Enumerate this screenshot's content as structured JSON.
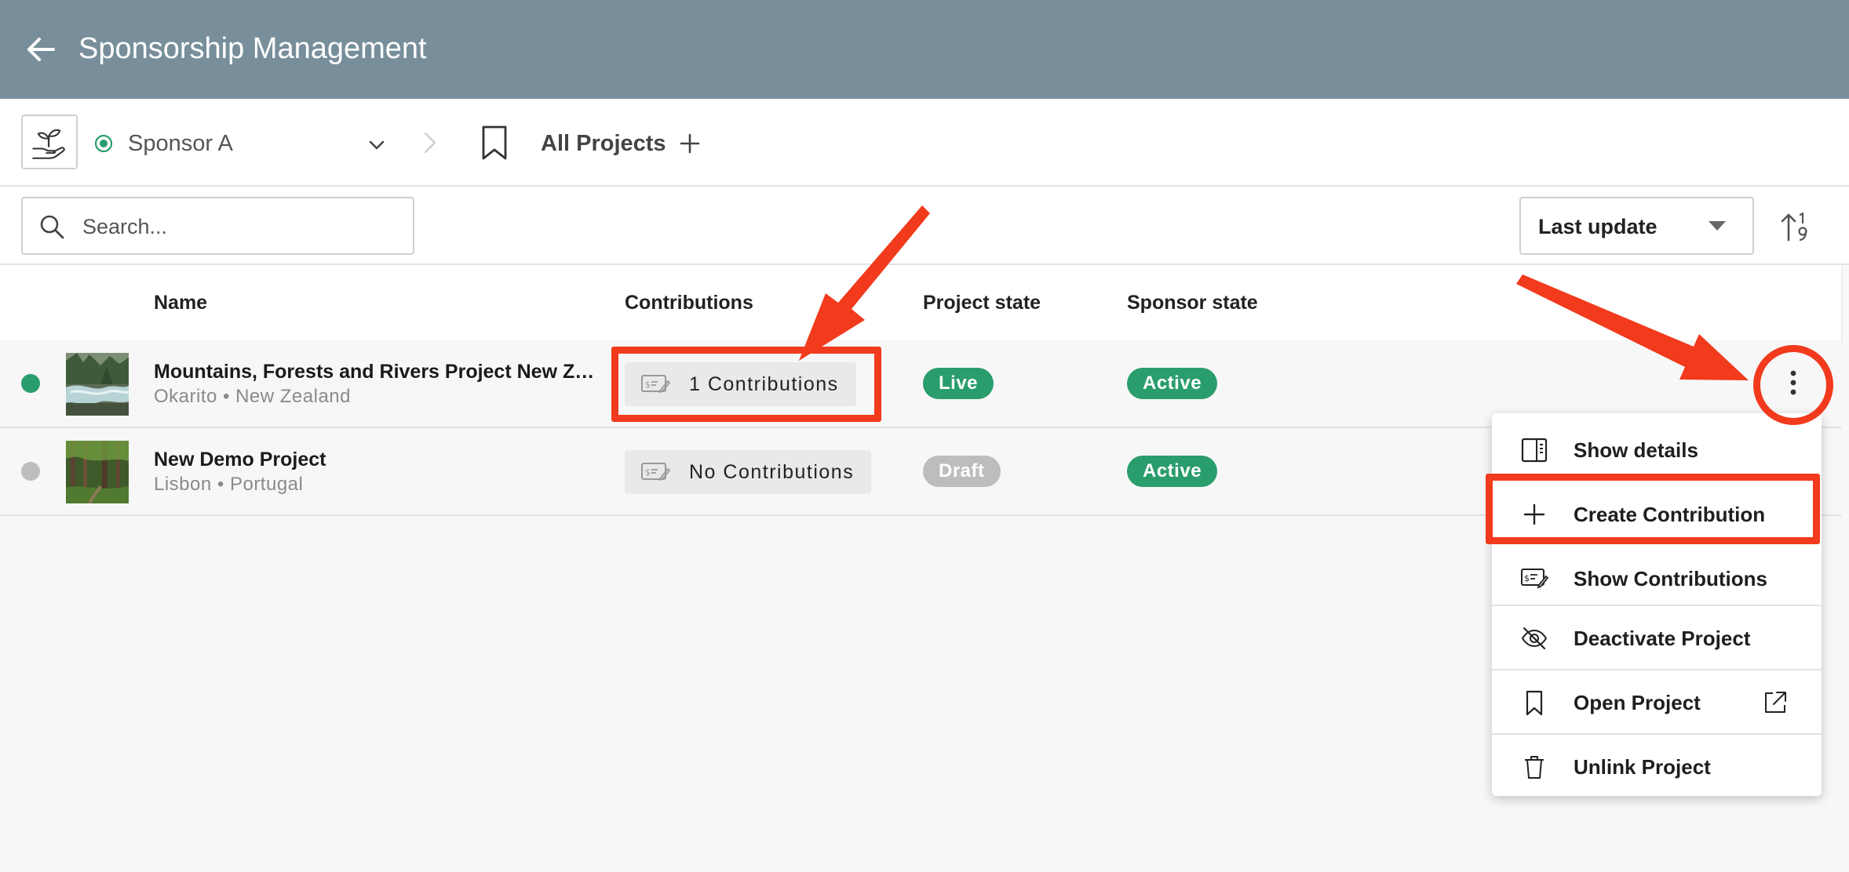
{
  "app_bar": {
    "title": "Sponsorship Management"
  },
  "nav": {
    "sponsor_name": "Sponsor A",
    "view_name": "All Projects"
  },
  "toolbar": {
    "search_placeholder": "Search...",
    "sort_label": "Last update"
  },
  "table": {
    "headers": {
      "name": "Name",
      "contributions": "Contributions",
      "project_state": "Project state",
      "sponsor_state": "Sponsor state"
    },
    "rows": [
      {
        "name": "Mountains, Forests and Rivers Project New Zealand",
        "location": "Okarito • New Zealand",
        "contributions": "1 Contributions",
        "project_state": "Live",
        "sponsor_state": "Active",
        "status_color": "#2a9d6d"
      },
      {
        "name": "New Demo Project",
        "location": "Lisbon • Portugal",
        "contributions": "No Contributions",
        "project_state": "Draft",
        "sponsor_state": "Active",
        "status_color": "#bdbdbd"
      }
    ]
  },
  "menu": {
    "items": [
      {
        "label": "Show details",
        "icon": "details-panel-icon"
      },
      {
        "label": "Create Contribution",
        "icon": "plus-icon"
      },
      {
        "label": "Show Contributions",
        "icon": "contribution-icon"
      },
      {
        "label": "Deactivate Project",
        "icon": "eye-off-icon"
      },
      {
        "label": "Open Project",
        "icon": "bookmark-icon"
      },
      {
        "label": "Unlink Project",
        "icon": "trash-icon"
      }
    ]
  },
  "colors": {
    "app_bar": "#788f9b",
    "accent_green": "#2a9d6d",
    "draft_gray": "#bdbdbd",
    "annotation_red": "#f23a1d"
  }
}
